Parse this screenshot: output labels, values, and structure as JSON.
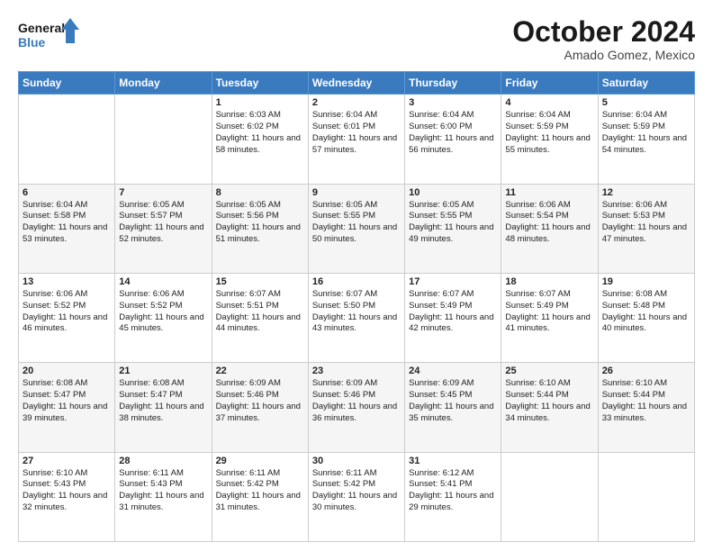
{
  "header": {
    "logo_line1": "General",
    "logo_line2": "Blue",
    "month": "October 2024",
    "location": "Amado Gomez, Mexico"
  },
  "weekdays": [
    "Sunday",
    "Monday",
    "Tuesday",
    "Wednesday",
    "Thursday",
    "Friday",
    "Saturday"
  ],
  "weeks": [
    [
      {
        "day": "",
        "content": ""
      },
      {
        "day": "",
        "content": ""
      },
      {
        "day": "1",
        "content": "Sunrise: 6:03 AM\nSunset: 6:02 PM\nDaylight: 11 hours and 58 minutes."
      },
      {
        "day": "2",
        "content": "Sunrise: 6:04 AM\nSunset: 6:01 PM\nDaylight: 11 hours and 57 minutes."
      },
      {
        "day": "3",
        "content": "Sunrise: 6:04 AM\nSunset: 6:00 PM\nDaylight: 11 hours and 56 minutes."
      },
      {
        "day": "4",
        "content": "Sunrise: 6:04 AM\nSunset: 5:59 PM\nDaylight: 11 hours and 55 minutes."
      },
      {
        "day": "5",
        "content": "Sunrise: 6:04 AM\nSunset: 5:59 PM\nDaylight: 11 hours and 54 minutes."
      }
    ],
    [
      {
        "day": "6",
        "content": "Sunrise: 6:04 AM\nSunset: 5:58 PM\nDaylight: 11 hours and 53 minutes."
      },
      {
        "day": "7",
        "content": "Sunrise: 6:05 AM\nSunset: 5:57 PM\nDaylight: 11 hours and 52 minutes."
      },
      {
        "day": "8",
        "content": "Sunrise: 6:05 AM\nSunset: 5:56 PM\nDaylight: 11 hours and 51 minutes."
      },
      {
        "day": "9",
        "content": "Sunrise: 6:05 AM\nSunset: 5:55 PM\nDaylight: 11 hours and 50 minutes."
      },
      {
        "day": "10",
        "content": "Sunrise: 6:05 AM\nSunset: 5:55 PM\nDaylight: 11 hours and 49 minutes."
      },
      {
        "day": "11",
        "content": "Sunrise: 6:06 AM\nSunset: 5:54 PM\nDaylight: 11 hours and 48 minutes."
      },
      {
        "day": "12",
        "content": "Sunrise: 6:06 AM\nSunset: 5:53 PM\nDaylight: 11 hours and 47 minutes."
      }
    ],
    [
      {
        "day": "13",
        "content": "Sunrise: 6:06 AM\nSunset: 5:52 PM\nDaylight: 11 hours and 46 minutes."
      },
      {
        "day": "14",
        "content": "Sunrise: 6:06 AM\nSunset: 5:52 PM\nDaylight: 11 hours and 45 minutes."
      },
      {
        "day": "15",
        "content": "Sunrise: 6:07 AM\nSunset: 5:51 PM\nDaylight: 11 hours and 44 minutes."
      },
      {
        "day": "16",
        "content": "Sunrise: 6:07 AM\nSunset: 5:50 PM\nDaylight: 11 hours and 43 minutes."
      },
      {
        "day": "17",
        "content": "Sunrise: 6:07 AM\nSunset: 5:49 PM\nDaylight: 11 hours and 42 minutes."
      },
      {
        "day": "18",
        "content": "Sunrise: 6:07 AM\nSunset: 5:49 PM\nDaylight: 11 hours and 41 minutes."
      },
      {
        "day": "19",
        "content": "Sunrise: 6:08 AM\nSunset: 5:48 PM\nDaylight: 11 hours and 40 minutes."
      }
    ],
    [
      {
        "day": "20",
        "content": "Sunrise: 6:08 AM\nSunset: 5:47 PM\nDaylight: 11 hours and 39 minutes."
      },
      {
        "day": "21",
        "content": "Sunrise: 6:08 AM\nSunset: 5:47 PM\nDaylight: 11 hours and 38 minutes."
      },
      {
        "day": "22",
        "content": "Sunrise: 6:09 AM\nSunset: 5:46 PM\nDaylight: 11 hours and 37 minutes."
      },
      {
        "day": "23",
        "content": "Sunrise: 6:09 AM\nSunset: 5:46 PM\nDaylight: 11 hours and 36 minutes."
      },
      {
        "day": "24",
        "content": "Sunrise: 6:09 AM\nSunset: 5:45 PM\nDaylight: 11 hours and 35 minutes."
      },
      {
        "day": "25",
        "content": "Sunrise: 6:10 AM\nSunset: 5:44 PM\nDaylight: 11 hours and 34 minutes."
      },
      {
        "day": "26",
        "content": "Sunrise: 6:10 AM\nSunset: 5:44 PM\nDaylight: 11 hours and 33 minutes."
      }
    ],
    [
      {
        "day": "27",
        "content": "Sunrise: 6:10 AM\nSunset: 5:43 PM\nDaylight: 11 hours and 32 minutes."
      },
      {
        "day": "28",
        "content": "Sunrise: 6:11 AM\nSunset: 5:43 PM\nDaylight: 11 hours and 31 minutes."
      },
      {
        "day": "29",
        "content": "Sunrise: 6:11 AM\nSunset: 5:42 PM\nDaylight: 11 hours and 31 minutes."
      },
      {
        "day": "30",
        "content": "Sunrise: 6:11 AM\nSunset: 5:42 PM\nDaylight: 11 hours and 30 minutes."
      },
      {
        "day": "31",
        "content": "Sunrise: 6:12 AM\nSunset: 5:41 PM\nDaylight: 11 hours and 29 minutes."
      },
      {
        "day": "",
        "content": ""
      },
      {
        "day": "",
        "content": ""
      }
    ]
  ]
}
